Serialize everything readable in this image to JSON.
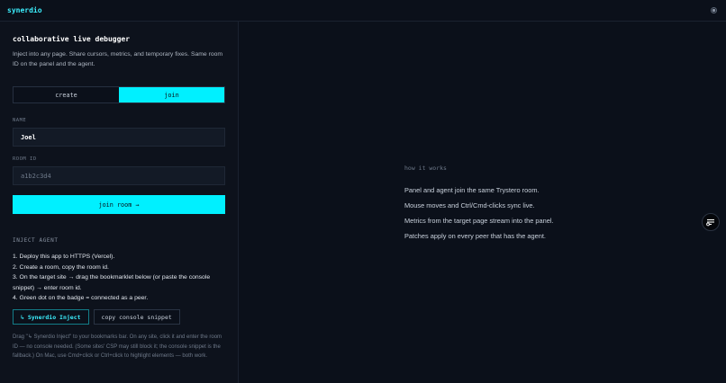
{
  "app": {
    "brand": "synerdio"
  },
  "panel": {
    "title": "collaborative live debugger",
    "subtitle": "Inject into any page. Share cursors, metrics, and temporary fixes. Same room ID on the panel and the agent.",
    "tabs": [
      {
        "label": "create",
        "active": false
      },
      {
        "label": "join",
        "active": true
      }
    ],
    "name_label": "NAME",
    "name_value": "Joel",
    "room_label": "ROOM ID",
    "room_placeholder": "a1b2c3d4",
    "join_button": "join room →",
    "inject": {
      "label": "INJECT AGENT",
      "steps": [
        "1. Deploy this app to HTTPS (Vercel).",
        "2. Create a room, copy the room id.",
        "3. On the target site → drag the bookmarklet below (or paste the console snippet) → enter room id.",
        "4. Green dot on the badge = connected as a peer."
      ],
      "bookmarklet_label": "↳ Synerdio Inject",
      "copy_label": "copy console snippet",
      "note": "Drag \"↳ Synerdio Inject\" to your bookmarks bar. On any site, click it and enter the room ID — no console needed. (Some sites' CSP may still block it; the console snippet is the fallback.) On Mac, use Cmd+click or Ctrl+click to highlight elements — both work."
    }
  },
  "how": {
    "title": "how it works",
    "items": [
      "Panel and agent join the same Trystero room.",
      "Mouse moves and Ctrl/Cmd-clicks sync live.",
      "Metrics from the target page stream into the panel.",
      "Patches apply on every peer that has the agent."
    ]
  },
  "icons": {
    "top_right": "settings-dot-icon",
    "floating": "toggle-panel-icon"
  },
  "colors": {
    "accent": "#00f0ff",
    "background": "#0b101a"
  }
}
